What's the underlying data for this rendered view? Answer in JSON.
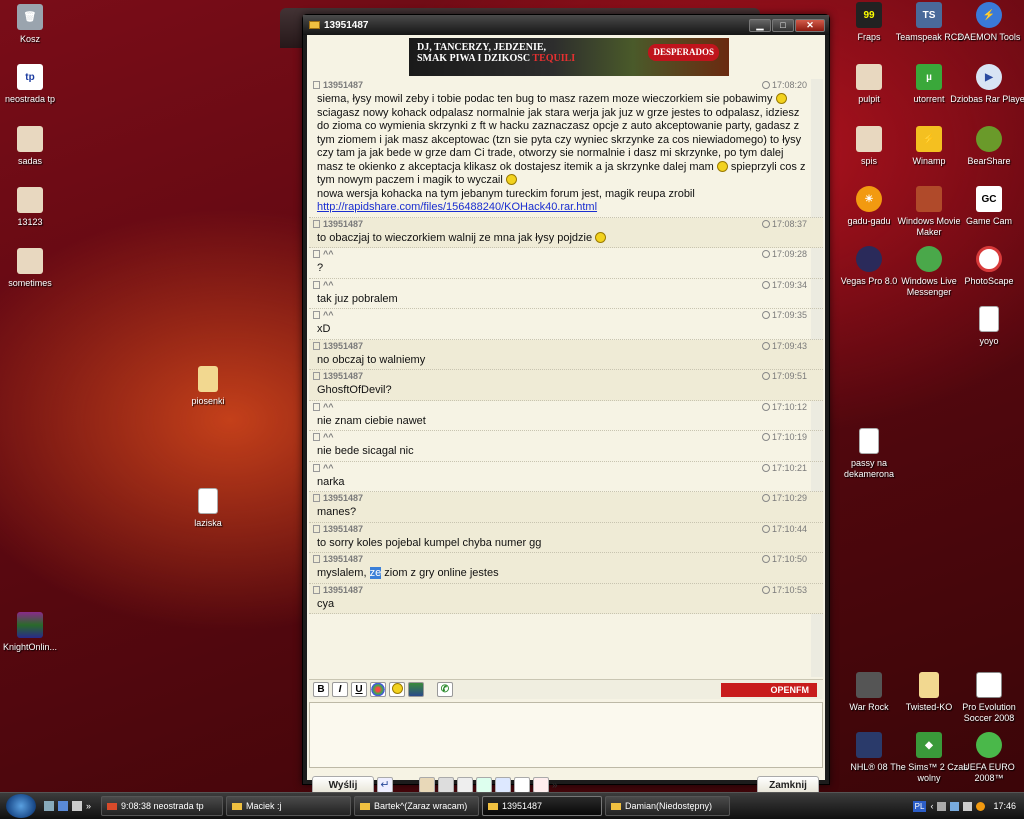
{
  "desktop_left": [
    {
      "name": "recycle-bin-icon",
      "label": "Kosz",
      "x": 0,
      "y": 0
    },
    {
      "name": "neostrada-icon",
      "label": "neostrada tp",
      "y": 1
    },
    {
      "name": "sadas-icon",
      "label": "sadas",
      "y": 2
    },
    {
      "name": "shortcut-13123-icon",
      "label": "13123",
      "y": 3
    },
    {
      "name": "sometimes-icon",
      "label": "sometimes",
      "y": 4
    },
    {
      "name": "knightonline-icon",
      "label": "KnightOnlin..."
    }
  ],
  "desktop_middle": [
    {
      "label": "piosenki"
    },
    {
      "label": "laziska"
    }
  ],
  "desktop_right": [
    {
      "label": "Fraps"
    },
    {
      "label": "Teamspeak RC2"
    },
    {
      "label": "DAEMON Tools"
    },
    {
      "label": "pulpit"
    },
    {
      "label": "utorrent"
    },
    {
      "label": "Dziobas Rar Player"
    },
    {
      "label": "spis"
    },
    {
      "label": "Winamp"
    },
    {
      "label": "BearShare"
    },
    {
      "label": "gadu-gadu"
    },
    {
      "label": "Windows Movie Maker"
    },
    {
      "label": "Game Cam"
    },
    {
      "label": "Vegas Pro 8.0"
    },
    {
      "label": "Windows Live Messenger"
    },
    {
      "label": "PhotoScape"
    },
    {
      "label": "yoyo"
    },
    {
      "label": "passy na dekamerona"
    },
    {
      "label": "War Rock"
    },
    {
      "label": "Twisted-KO"
    },
    {
      "label": "Pro Evolution Soccer 2008"
    },
    {
      "label": "NHL® 08"
    },
    {
      "label": "The Sims™ 2 Czas wolny"
    },
    {
      "label": "UEFA EURO 2008™"
    }
  ],
  "chat": {
    "title": "13951487",
    "banner": {
      "line1": "DJ, TANCERZY, JEDZENIE,",
      "line2": "SMAK PIWA I DZIKOSC",
      "line2_accent": "TEQUILI",
      "brand": "DESPERADOS"
    },
    "messages": [
      {
        "author": "13951487",
        "time": "17:08:20",
        "text_before": "siema, łysy mowil zeby i tobie podac ten bug to masz razem moze wieczorkiem sie pobawimy",
        "text_after": "sciagasz nowy kohack odpalasz normalnie jak stara werja jak juz w grze jestes to odpalasz, idziesz do zioma co wymienia skrzynki z ft w hacku zaznaczasz opcje z auto akceptowanie party, gadasz z tym ziomem i jak masz akceptowac (tzn sie pyta czy wyniec skrzynke za cos niewiadomego) to łysy czy tam ja jak bede w grze dam Ci trade, otworzy sie normalnie i dasz mi skrzynke, po tym dalej masz te okienko z akceptacja klikasz ok dostajesz itemik a ja skrzynke dalej mam",
        "text_after2": "spieprzyli cos z tym nowym paczem i magik to wyczail",
        "text_after3": "nowa wersja kohacka na tym jebanym tureckim forum jest, magik reupa zrobil",
        "link": "http://rapidshare.com/files/156488240/KOHack40.rar.html"
      },
      {
        "author": "13951487",
        "time": "17:08:37",
        "text": "to obaczjaj to wieczorkiem walnij ze mna jak łysy pojdzie"
      },
      {
        "author": "^^",
        "time": "17:09:28",
        "text": "?"
      },
      {
        "author": "^^",
        "time": "17:09:34",
        "text": "tak juz pobralem"
      },
      {
        "author": "^^",
        "time": "17:09:35",
        "text": "xD"
      },
      {
        "author": "13951487",
        "time": "17:09:43",
        "text": "no obczaj to walniemy"
      },
      {
        "author": "13951487",
        "time": "17:09:51",
        "text": "GhosftOfDevil?"
      },
      {
        "author": "^^",
        "time": "17:10:12",
        "text": "nie znam ciebie nawet"
      },
      {
        "author": "^^",
        "time": "17:10:19",
        "text": "nie bede sicagal nic"
      },
      {
        "author": "^^",
        "time": "17:10:21",
        "text": "narka"
      },
      {
        "author": "13951487",
        "time": "17:10:29",
        "text": "manes?"
      },
      {
        "author": "13951487",
        "time": "17:10:44",
        "text": "to sorry koles pojebal kumpel chyba numer gg"
      },
      {
        "author": "13951487",
        "time": "17:10:50",
        "text_before": "myslalem,",
        "highlight": "ze",
        "text_after": "ziom z gry online jestes"
      },
      {
        "author": "13951487",
        "time": "17:10:53",
        "text": "cya"
      }
    ],
    "format_buttons": {
      "bold": "B",
      "italic": "I",
      "underline": "U"
    },
    "radio_label": "OPENFM",
    "send_label": "Wyślij",
    "close_label": "Zamknij"
  },
  "taskbar": {
    "tasks": [
      "9:08:38 neostrada tp",
      "Maciek :j",
      "Bartek^(Zaraz wracam)",
      "13951487",
      "Damian(Niedostępny)"
    ],
    "lang": "PL",
    "clock": "17:46"
  },
  "colors": {
    "accent": "#3a7fd8",
    "link": "#1a2ed0",
    "openfm": "#c81c1c"
  }
}
